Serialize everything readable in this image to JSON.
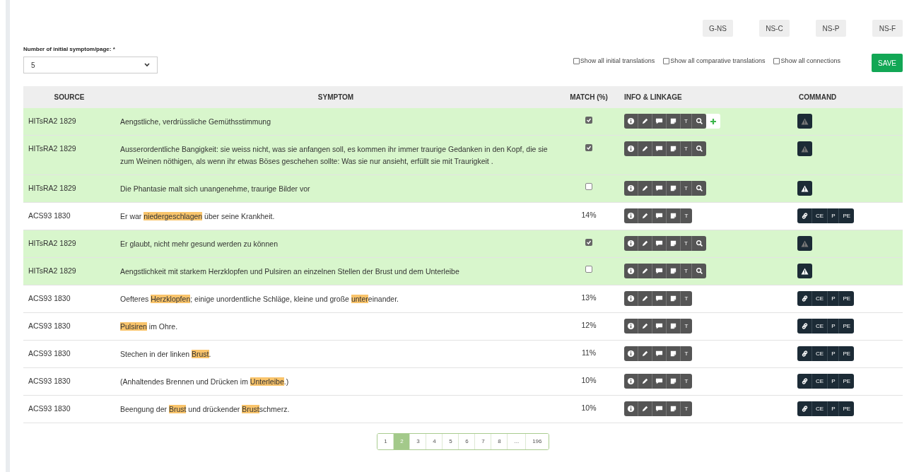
{
  "mode_buttons": [
    "G-NS",
    "NS-C",
    "NS-P",
    "NS-F"
  ],
  "per_page": {
    "label": "Number of initial symptom/page: *",
    "value": "5"
  },
  "toggles": [
    {
      "label": "Show all initial translations",
      "checked": false
    },
    {
      "label": "Show all comparative translations",
      "checked": false
    },
    {
      "label": "Show all connections",
      "checked": false
    }
  ],
  "save_button": "SAVE",
  "table": {
    "columns": [
      "SOURCE",
      "SYMPTOM",
      "MATCH (%)",
      "INFO & LINKAGE",
      "COMMAND"
    ],
    "rows": [
      {
        "kind": "initial",
        "source": "HITsRA2 1829",
        "symptom": [
          {
            "text": "Aengstliche, verdrüssliche Gemüthsstimmung",
            "highlight": false
          }
        ],
        "checked": true,
        "show_add": true,
        "tool_label": "T"
      },
      {
        "kind": "initial",
        "source": "HITsRA2 1829",
        "symptom": [
          {
            "text": "Ausserordentliche Bangigkeit: sie weiss nicht, was sie anfangen soll, es kommen ihr immer traurige Gedanken in den Kopf, die sie zum Weinen nöthigen, als wenn ihr etwas Böses geschehen sollte: Was sie nur ansieht, erfüllt sie mit Traurigkeit .",
            "highlight": false
          }
        ],
        "checked": true,
        "show_add": false,
        "tool_label": "T"
      },
      {
        "kind": "initial",
        "source": "HITsRA2 1829",
        "symptom": [
          {
            "text": "Die Phantasie malt sich unangenehme, traurige Bilder vor",
            "highlight": false
          }
        ],
        "checked": false,
        "show_add": false,
        "tool_label": "T"
      },
      {
        "kind": "comparative",
        "source": "ACS93 1830",
        "symptom": [
          {
            "text": "Er war ",
            "highlight": false
          },
          {
            "text": "niedergeschlagen",
            "highlight": true
          },
          {
            "text": " über seine Krankheit.",
            "highlight": false
          }
        ],
        "match": "14%",
        "tool_label": "T",
        "commands": [
          "CE",
          "P",
          "PE"
        ]
      },
      {
        "kind": "initial",
        "source": "HITsRA2 1829",
        "symptom": [
          {
            "text": "Er glaubt, nicht mehr gesund werden zu können",
            "highlight": false
          }
        ],
        "checked": true,
        "show_add": false,
        "tool_label": "T"
      },
      {
        "kind": "initial",
        "source": "HITsRA2 1829",
        "symptom": [
          {
            "text": "Aengstlichkeit mit starkem Herzklopfen und Pulsiren an einzelnen Stellen der Brust und dem Unterleibe",
            "highlight": false
          }
        ],
        "checked": false,
        "show_add": false,
        "tool_label": "T"
      },
      {
        "kind": "comparative",
        "source": "ACS93 1830",
        "symptom": [
          {
            "text": "Oefteres ",
            "highlight": false
          },
          {
            "text": "Herzklopfen",
            "highlight": true
          },
          {
            "text": "; einige unordentliche Schläge, kleine und große ",
            "highlight": false
          },
          {
            "text": "unter",
            "highlight": true
          },
          {
            "text": "einander.",
            "highlight": false
          }
        ],
        "match": "13%",
        "tool_label": "T",
        "commands": [
          "CE",
          "P",
          "PE"
        ]
      },
      {
        "kind": "comparative",
        "source": "ACS93 1830",
        "symptom": [
          {
            "text": "Pulsiren",
            "highlight": true
          },
          {
            "text": " im Ohre.",
            "highlight": false
          }
        ],
        "match": "12%",
        "tool_label": "T",
        "commands": [
          "CE",
          "P",
          "PE"
        ]
      },
      {
        "kind": "comparative",
        "source": "ACS93 1830",
        "symptom": [
          {
            "text": "Stechen in der linken ",
            "highlight": false
          },
          {
            "text": "Brust",
            "highlight": true
          },
          {
            "text": ".",
            "highlight": false
          }
        ],
        "match": "11%",
        "tool_label": "T",
        "commands": [
          "CE",
          "P",
          "PE"
        ]
      },
      {
        "kind": "comparative",
        "source": "ACS93 1830",
        "symptom": [
          {
            "text": "(Anhaltendes Brennen und Drücken im ",
            "highlight": false
          },
          {
            "text": "Unterleibe",
            "highlight": true
          },
          {
            "text": ".)",
            "highlight": false
          }
        ],
        "match": "10%",
        "tool_label": "T",
        "commands": [
          "CE",
          "P",
          "PE"
        ]
      },
      {
        "kind": "comparative",
        "source": "ACS93 1830",
        "symptom": [
          {
            "text": "Beengung der ",
            "highlight": false
          },
          {
            "text": "Brust",
            "highlight": true
          },
          {
            "text": " und drückender ",
            "highlight": false
          },
          {
            "text": "Brust",
            "highlight": true
          },
          {
            "text": "schmerz.",
            "highlight": false
          }
        ],
        "match": "10%",
        "tool_label": "T",
        "commands": [
          "CE",
          "P",
          "PE"
        ]
      }
    ]
  },
  "pagination": [
    {
      "label": "1",
      "selected": false
    },
    {
      "label": "2",
      "selected": true
    },
    {
      "label": "3",
      "selected": false
    },
    {
      "label": "4",
      "selected": false
    },
    {
      "label": "5",
      "selected": false
    },
    {
      "label": "6",
      "selected": false
    },
    {
      "label": "7",
      "selected": false
    },
    {
      "label": "8",
      "selected": false
    },
    {
      "label": "...",
      "selected": false
    },
    {
      "label": "196",
      "selected": false
    }
  ]
}
